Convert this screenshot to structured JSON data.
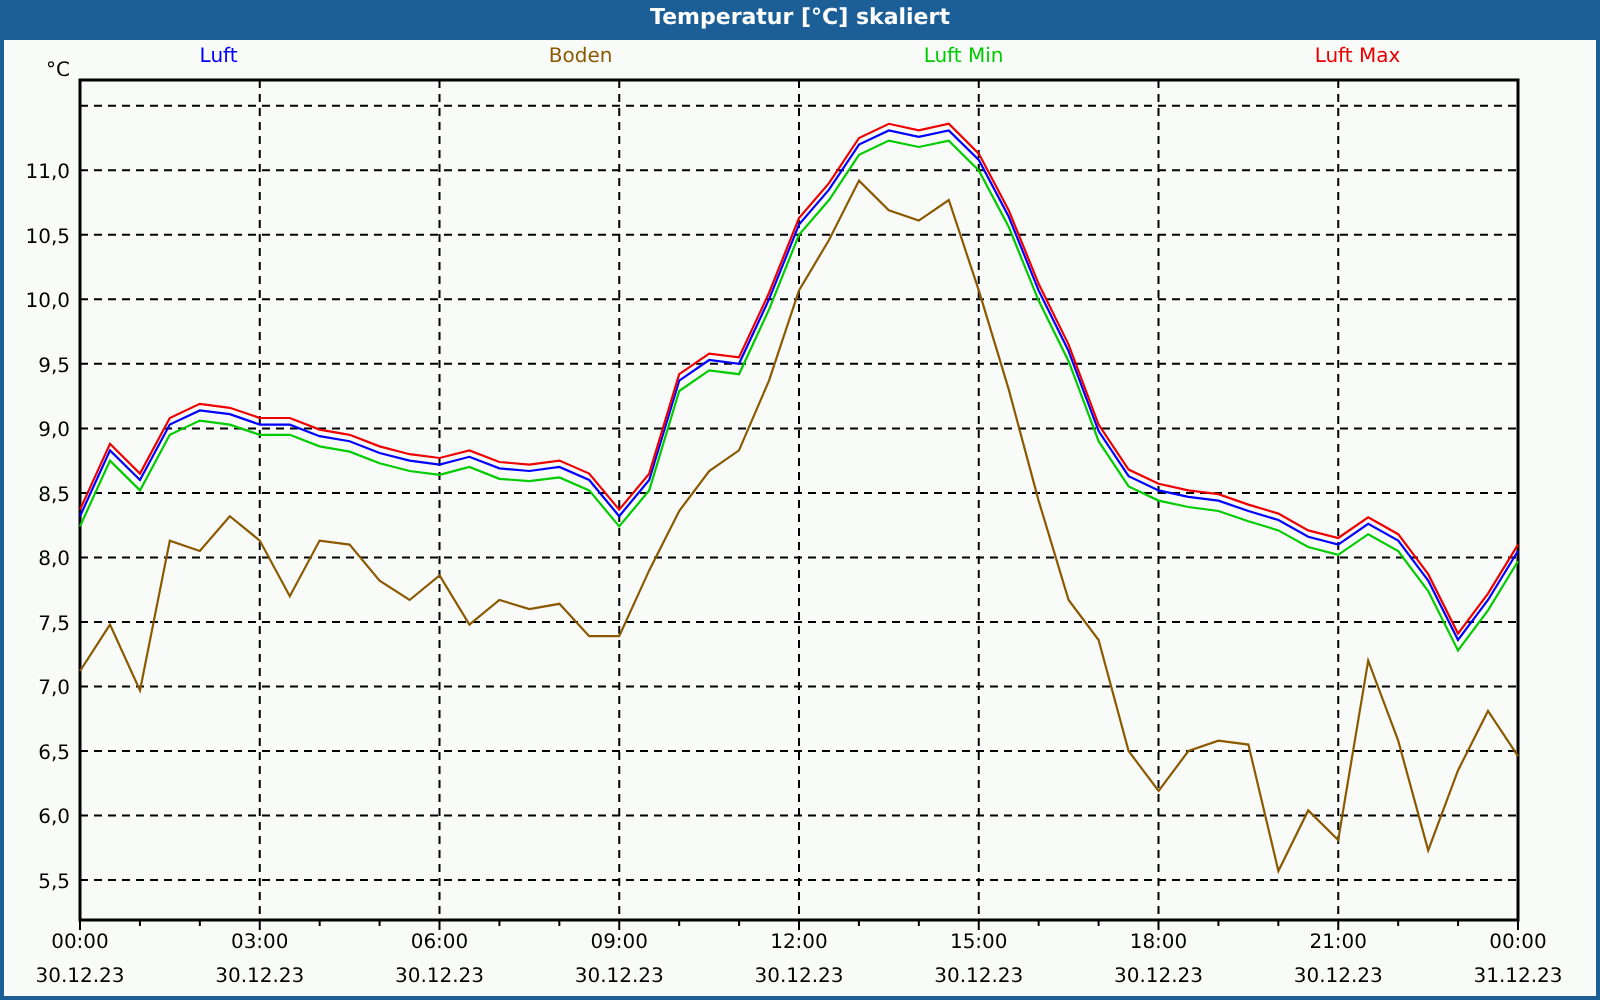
{
  "window": {
    "title": "Temperatur [°C] skaliert"
  },
  "chart": {
    "chart_data": {
      "type": "line",
      "ylabel": "°C",
      "categories": [
        "00:00\n30.12.23",
        null,
        null,
        null,
        null,
        null,
        "03:00\n30.12.23",
        null,
        null,
        null,
        null,
        null,
        "06:00\n30.12.23",
        null,
        null,
        null,
        null,
        null,
        "09:00\n30.12.23",
        null,
        null,
        null,
        null,
        null,
        "12:00\n30.12.23",
        null,
        null,
        null,
        null,
        null,
        "15:00\n30.12.23",
        null,
        null,
        null,
        null,
        null,
        "18:00\n30.12.23",
        null,
        null,
        null,
        null,
        null,
        "21:00\n30.12.23",
        null,
        null,
        null,
        null,
        null,
        "00:00\n31.12.23"
      ],
      "series": [
        {
          "name": "Luft",
          "color": "#0000ff",
          "values": [
            8.32,
            8.83,
            8.6,
            9.03,
            9.14,
            9.11,
            9.03,
            9.03,
            8.94,
            8.9,
            8.81,
            8.75,
            8.72,
            8.78,
            8.69,
            8.67,
            8.7,
            8.6,
            8.32,
            8.6,
            9.37,
            9.53,
            9.5,
            10.0,
            10.58,
            10.85,
            11.2,
            11.31,
            11.26,
            11.31,
            11.08,
            10.64,
            10.07,
            9.6,
            8.98,
            8.63,
            8.52,
            8.47,
            8.44,
            8.36,
            8.29,
            8.16,
            8.1,
            8.26,
            8.13,
            7.82,
            7.36,
            7.67,
            8.05
          ]
        },
        {
          "name": "Boden",
          "color": "#8b5a00",
          "values": [
            7.12,
            7.48,
            6.97,
            8.13,
            8.05,
            8.32,
            8.13,
            7.7,
            8.13,
            8.1,
            7.82,
            7.67,
            7.86,
            7.48,
            7.67,
            7.6,
            7.64,
            7.39,
            7.39,
            7.9,
            8.36,
            8.67,
            8.83,
            9.37,
            10.07,
            10.46,
            10.92,
            10.69,
            10.61,
            10.77,
            10.07,
            9.3,
            8.44,
            7.67,
            7.36,
            6.5,
            6.19,
            6.5,
            6.58,
            6.55,
            5.57,
            6.04,
            5.81,
            7.2,
            6.58,
            5.73,
            6.35,
            6.81,
            6.46
          ]
        },
        {
          "name": "Luft Min",
          "color": "#00cc00",
          "values": [
            8.24,
            8.75,
            8.52,
            8.95,
            9.06,
            9.03,
            8.95,
            8.95,
            8.86,
            8.82,
            8.73,
            8.67,
            8.64,
            8.7,
            8.61,
            8.59,
            8.62,
            8.52,
            8.24,
            8.52,
            9.29,
            9.45,
            9.42,
            9.92,
            10.5,
            10.77,
            11.12,
            11.23,
            11.18,
            11.23,
            11.0,
            10.56,
            9.99,
            9.52,
            8.9,
            8.55,
            8.44,
            8.39,
            8.36,
            8.28,
            8.21,
            8.08,
            8.02,
            8.18,
            8.05,
            7.74,
            7.28,
            7.59,
            7.97
          ]
        },
        {
          "name": "Luft Max",
          "color": "#ee0000",
          "values": [
            8.37,
            8.88,
            8.65,
            9.08,
            9.19,
            9.16,
            9.08,
            9.08,
            8.99,
            8.95,
            8.86,
            8.8,
            8.77,
            8.83,
            8.74,
            8.72,
            8.75,
            8.65,
            8.37,
            8.65,
            9.42,
            9.58,
            9.55,
            10.05,
            10.63,
            10.9,
            11.25,
            11.36,
            11.31,
            11.36,
            11.13,
            10.69,
            10.12,
            9.65,
            9.03,
            8.68,
            8.57,
            8.52,
            8.49,
            8.41,
            8.34,
            8.21,
            8.15,
            8.31,
            8.18,
            7.87,
            7.41,
            7.72,
            8.1
          ]
        }
      ],
      "grid": true,
      "ylim": [
        5.19,
        11.7
      ],
      "yticks": [
        {
          "value": 5.5,
          "label": "5,5"
        },
        {
          "value": 6,
          "label": "6,0"
        },
        {
          "value": 6.5,
          "label": "6,5"
        },
        {
          "value": 7,
          "label": "7,0"
        },
        {
          "value": 7.5,
          "label": "7,5"
        },
        {
          "value": 8,
          "label": "8,0"
        },
        {
          "value": 8.5,
          "label": "8,5"
        },
        {
          "value": 9,
          "label": "9,0"
        },
        {
          "value": 9.5,
          "label": "9,5"
        },
        {
          "value": 10,
          "label": "10,0"
        },
        {
          "value": 10.5,
          "label": "10,5"
        },
        {
          "value": 11,
          "label": "11,0"
        }
      ]
    }
  }
}
